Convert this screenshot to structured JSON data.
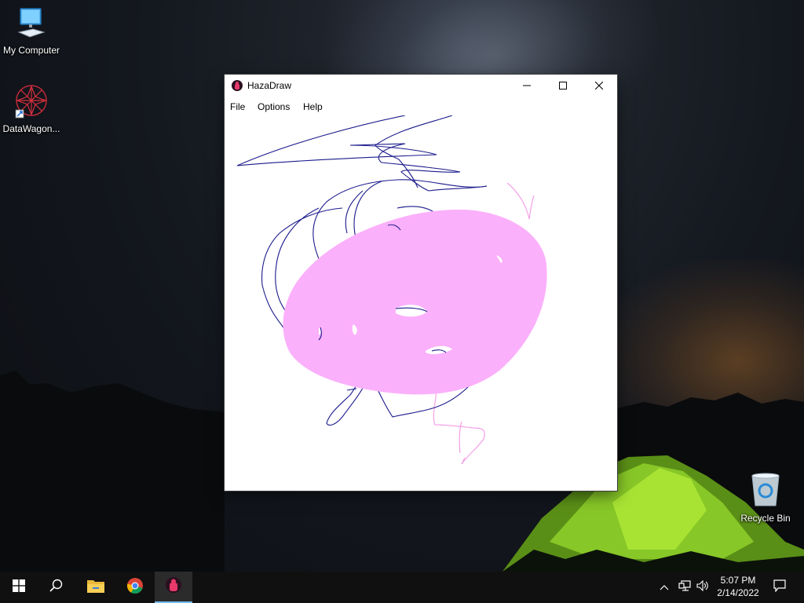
{
  "desktop": {
    "icons": [
      {
        "label": "My Computer",
        "icon": "computer-icon"
      },
      {
        "label": "DataWagon...",
        "icon": "datawagon-icon"
      },
      {
        "label": "Recycle Bin",
        "icon": "recycle-bin-icon"
      }
    ]
  },
  "window": {
    "title": "HazaDraw",
    "app_icon": "hazadraw-icon",
    "controls": [
      "minimize-icon",
      "maximize-icon",
      "close-icon"
    ],
    "menu": [
      "File",
      "Options",
      "Help"
    ],
    "canvas": {
      "background": "#ffffff",
      "stroke_colors": {
        "pen_blue": "#1a1a8c",
        "pink_fill": "#fbb0fb",
        "pink_line": "#f5a0e8"
      }
    }
  },
  "taskbar": {
    "buttons": [
      "start-icon",
      "search-icon",
      "file-explorer-icon",
      "chrome-icon",
      "hazadraw-icon"
    ],
    "active_button": "hazadraw-icon",
    "tray_icons": [
      "chevron-up-icon",
      "network-icon",
      "volume-icon",
      "notification-icon"
    ],
    "time": "5:07 PM",
    "date": "2/14/2022"
  }
}
